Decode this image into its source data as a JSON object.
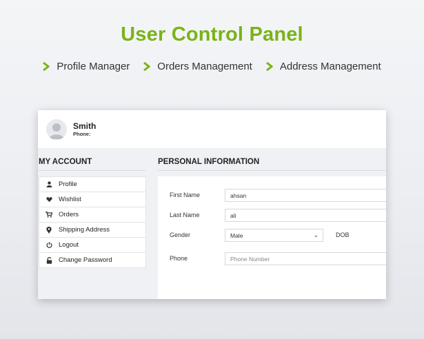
{
  "banner": {
    "title": "User Control Panel",
    "features": [
      "Profile Manager",
      "Orders Management",
      "Address Management"
    ],
    "accent_color": "#7ab317"
  },
  "user": {
    "name": "Smith",
    "phone_label": "Phone:"
  },
  "sidebar": {
    "title": "MY ACCOUNT",
    "items": [
      {
        "label": "Profile",
        "icon": "user-icon"
      },
      {
        "label": "Wishlist",
        "icon": "heart-icon"
      },
      {
        "label": "Orders",
        "icon": "cart-icon"
      },
      {
        "label": "Shipping Address",
        "icon": "map-pin-icon"
      },
      {
        "label": "Logout",
        "icon": "power-icon"
      },
      {
        "label": "Change Password",
        "icon": "unlock-icon"
      }
    ]
  },
  "main": {
    "title": "PERSONAL INFORMATION",
    "form": {
      "first_name_label": "First Name",
      "first_name_value": "ahsan",
      "last_name_label": "Last Name",
      "last_name_value": "ali",
      "gender_label": "Gender",
      "gender_value": "Male",
      "dob_label": "DOB",
      "phone_label": "Phone",
      "phone_placeholder": "Phone Number"
    }
  }
}
